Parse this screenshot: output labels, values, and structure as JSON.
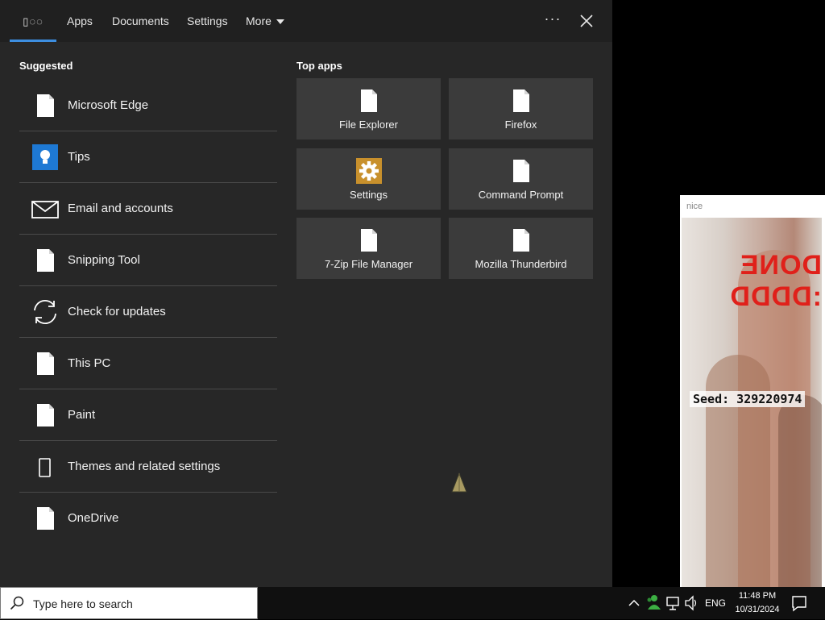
{
  "topbar": {
    "tabs": [
      {
        "label": "▯◌◌",
        "active": true
      },
      {
        "label": "Apps"
      },
      {
        "label": "Documents"
      },
      {
        "label": "Settings"
      },
      {
        "label": "More"
      }
    ],
    "ellipsis": "···",
    "accent_color": "#3d8ee0"
  },
  "suggested": {
    "title": "Suggested",
    "items": [
      {
        "label": "Microsoft Edge",
        "icon": "document-icon"
      },
      {
        "label": "Tips",
        "icon": "lightbulb-icon"
      },
      {
        "label": "Email and accounts",
        "icon": "mail-icon"
      },
      {
        "label": "Snipping Tool",
        "icon": "document-icon"
      },
      {
        "label": "Check for updates",
        "icon": "refresh-icon"
      },
      {
        "label": "This PC",
        "icon": "document-icon"
      },
      {
        "label": "Paint",
        "icon": "document-icon"
      },
      {
        "label": "Themes and related settings",
        "icon": "phone-icon"
      },
      {
        "label": "OneDrive",
        "icon": "document-icon"
      }
    ]
  },
  "top_apps": {
    "title": "Top apps",
    "tiles": [
      {
        "label": "File Explorer",
        "icon": "document-icon"
      },
      {
        "label": "Firefox",
        "icon": "document-icon"
      },
      {
        "label": "Settings",
        "icon": "gear-icon"
      },
      {
        "label": "Command Prompt",
        "icon": "document-icon"
      },
      {
        "label": "7-Zip File Manager",
        "icon": "document-icon"
      },
      {
        "label": "Mozilla Thunderbird",
        "icon": "document-icon"
      }
    ]
  },
  "side_window": {
    "title": "nice",
    "image_text": {
      "headline": "DONE :DDDD",
      "seed": "Seed: 329220974"
    }
  },
  "taskbar": {
    "search_placeholder": "Type here to search",
    "language": "ENG",
    "time": "11:48 PM",
    "date": "10/31/2024"
  }
}
